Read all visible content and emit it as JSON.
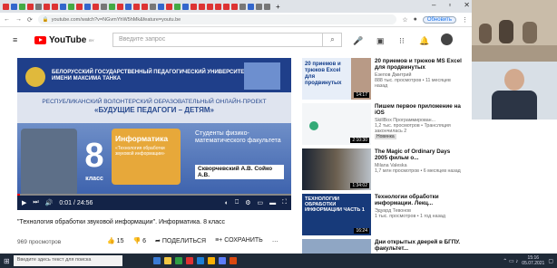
{
  "browser": {
    "url": "youtube.com/watch?v=NGvmYhW5hMk&feature=youtu.be",
    "update_label": "Обновить",
    "tab_new": "+",
    "win_minimize": "–",
    "win_maximize": "▫",
    "win_close": "✕"
  },
  "youtube": {
    "logo": "YouTube",
    "logo_region": "BY",
    "search_placeholder": "Введите запрос"
  },
  "video": {
    "banner_line1": "БЕЛОРУССКИЙ ГОСУДАРСТВЕННЫЙ ПЕДАГОГИЧЕСКИЙ УНИВЕРСИТЕТ",
    "banner_line2": "ИМЕНИ МАКСИМА ТАНКА",
    "project_line": "РЕСПУБЛИКАНСКИЙ ВОЛОНТЕРСКИЙ ОБРАЗОВАТЕЛЬНЫЙ ОНЛАЙН-ПРОЕКТ",
    "project_name": "«БУДУЩИЕ ПЕДАГОГИ – ДЕТЯМ»",
    "grade_number": "8",
    "grade_label": "класс",
    "subject": "Информатика",
    "subject_topic": "«Технология обработки звуковой информации»",
    "students_text": "Студенты физико-математического факультета",
    "authors": "Скворчевский А.В. Сойко А.В.",
    "time": "0:01 / 24:56",
    "title": "\"Технология обработки звуковой информации\". Информатика. 8 класс",
    "views": "969 просмотров",
    "likes": "15",
    "dislikes": "6",
    "share_label": "ПОДЕЛИТЬСЯ",
    "save_label": "СОХРАНИТЬ"
  },
  "recommendations": [
    {
      "title": "20 приемов и трюков MS Excel для продвинутых",
      "channel": "Езепов Дмитрий",
      "meta": "888 тыс. просмотров • 11 месяцев назад",
      "duration": "14:17",
      "thumb_text": "20 приемов и трюков Excel для продвинутых",
      "badge": ""
    },
    {
      "title": "Пишем первое приложение на iOS",
      "channel": "SkillBox Программирован...",
      "meta": "1,2 тыс. просмотров • Трансляция закончилась 2",
      "duration": "2:10:30",
      "thumb_text": "",
      "badge": "Новинка"
    },
    {
      "title": "The Magic of Ordinary Days 2005 фильм о...",
      "channel": "Milana Valeska",
      "meta": "1,7 млн просмотров • 6 месяцев назад",
      "duration": "1:34:02",
      "thumb_text": "",
      "badge": ""
    },
    {
      "title": "Технологии обработки информации. Лекц...",
      "channel": "Эдуард Тевонов",
      "meta": "1 тыс. просмотров • 1 год назад",
      "duration": "16:24",
      "thumb_text": "ТЕХНОЛОГИИ ОБРАБОТКИ ИНФОРМАЦИИ ЧАСТЬ 1",
      "badge": ""
    },
    {
      "title": "Дни открытых дверей в БГПУ. факультет...",
      "channel": "",
      "meta": "",
      "duration": "",
      "thumb_text": "",
      "badge": ""
    }
  ],
  "taskbar": {
    "search_placeholder": "Введите здесь текст для поиска",
    "time": "15:16",
    "date": "05.07.2021"
  },
  "colors": {
    "youtube_red": "#ff0000",
    "banner_blue": "#1f3f8a",
    "subject_orange": "#e7a83a"
  }
}
